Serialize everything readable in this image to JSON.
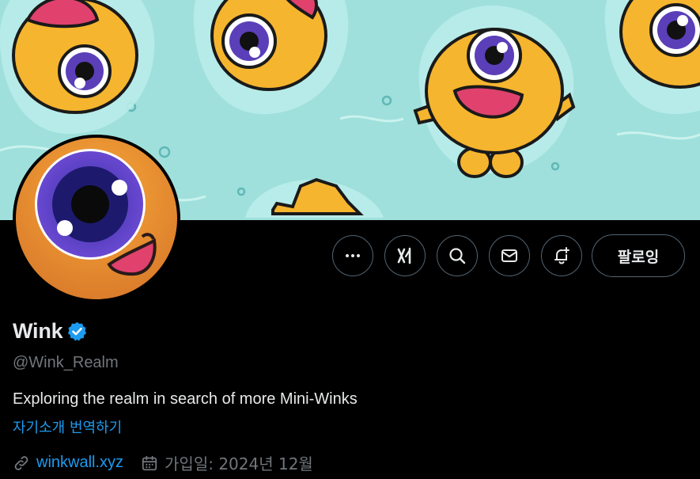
{
  "profile": {
    "display_name": "Wink",
    "handle": "@Wink_Realm",
    "bio": "Exploring the realm in search of more Mini-Winks",
    "translate_label": "자기소개 번역하기",
    "website": "winkwall.xyz",
    "joined": "가입일: 2024년 12월"
  },
  "actions": {
    "follow_label": "팔로잉",
    "icons": [
      "more-icon",
      "grok-icon",
      "search-icon",
      "mail-icon",
      "notify-bell-icon"
    ]
  },
  "colors": {
    "accent": "#1d9bf0",
    "banner": "#9fe0dc",
    "character": "#f6b52e",
    "eye_iris": "#5b3fb8"
  }
}
